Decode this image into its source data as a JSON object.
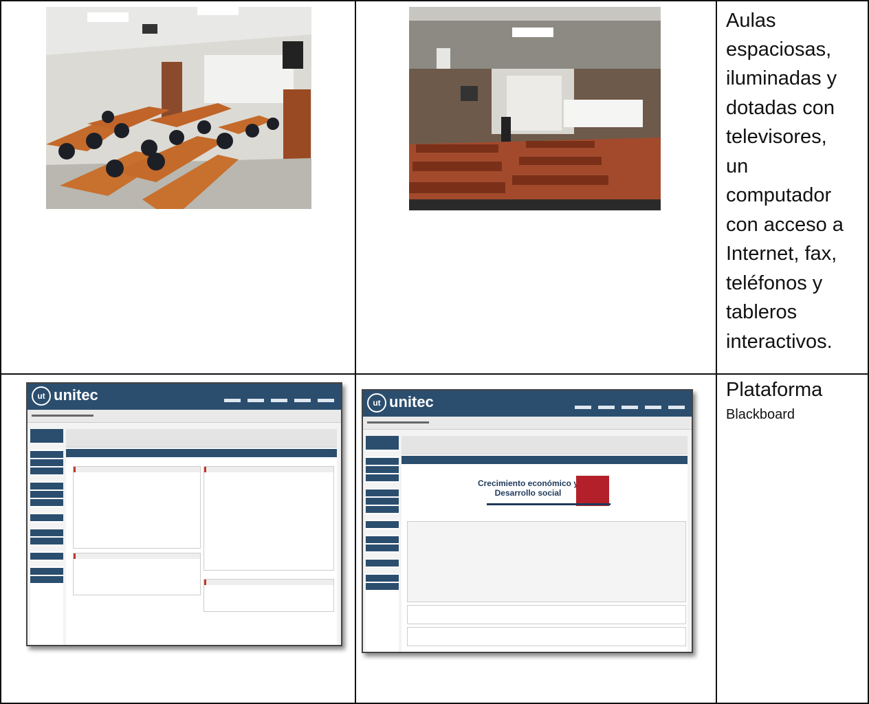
{
  "rows": [
    {
      "description_lines": [
        "Aulas",
        "espaciosas,",
        "iluminadas y",
        "dotadas con",
        "televisores,",
        "un",
        "computador",
        "con acceso a",
        "Internet, fax,",
        "teléfonos y",
        "tableros",
        "interactivos."
      ]
    },
    {
      "description_title": "Plataforma",
      "description_subtitle": "Blackboard",
      "screenshot_right_heading": "Crecimiento económico y",
      "screenshot_right_heading2": "Desarrollo social",
      "screenshot_logo": "unitec"
    }
  ]
}
